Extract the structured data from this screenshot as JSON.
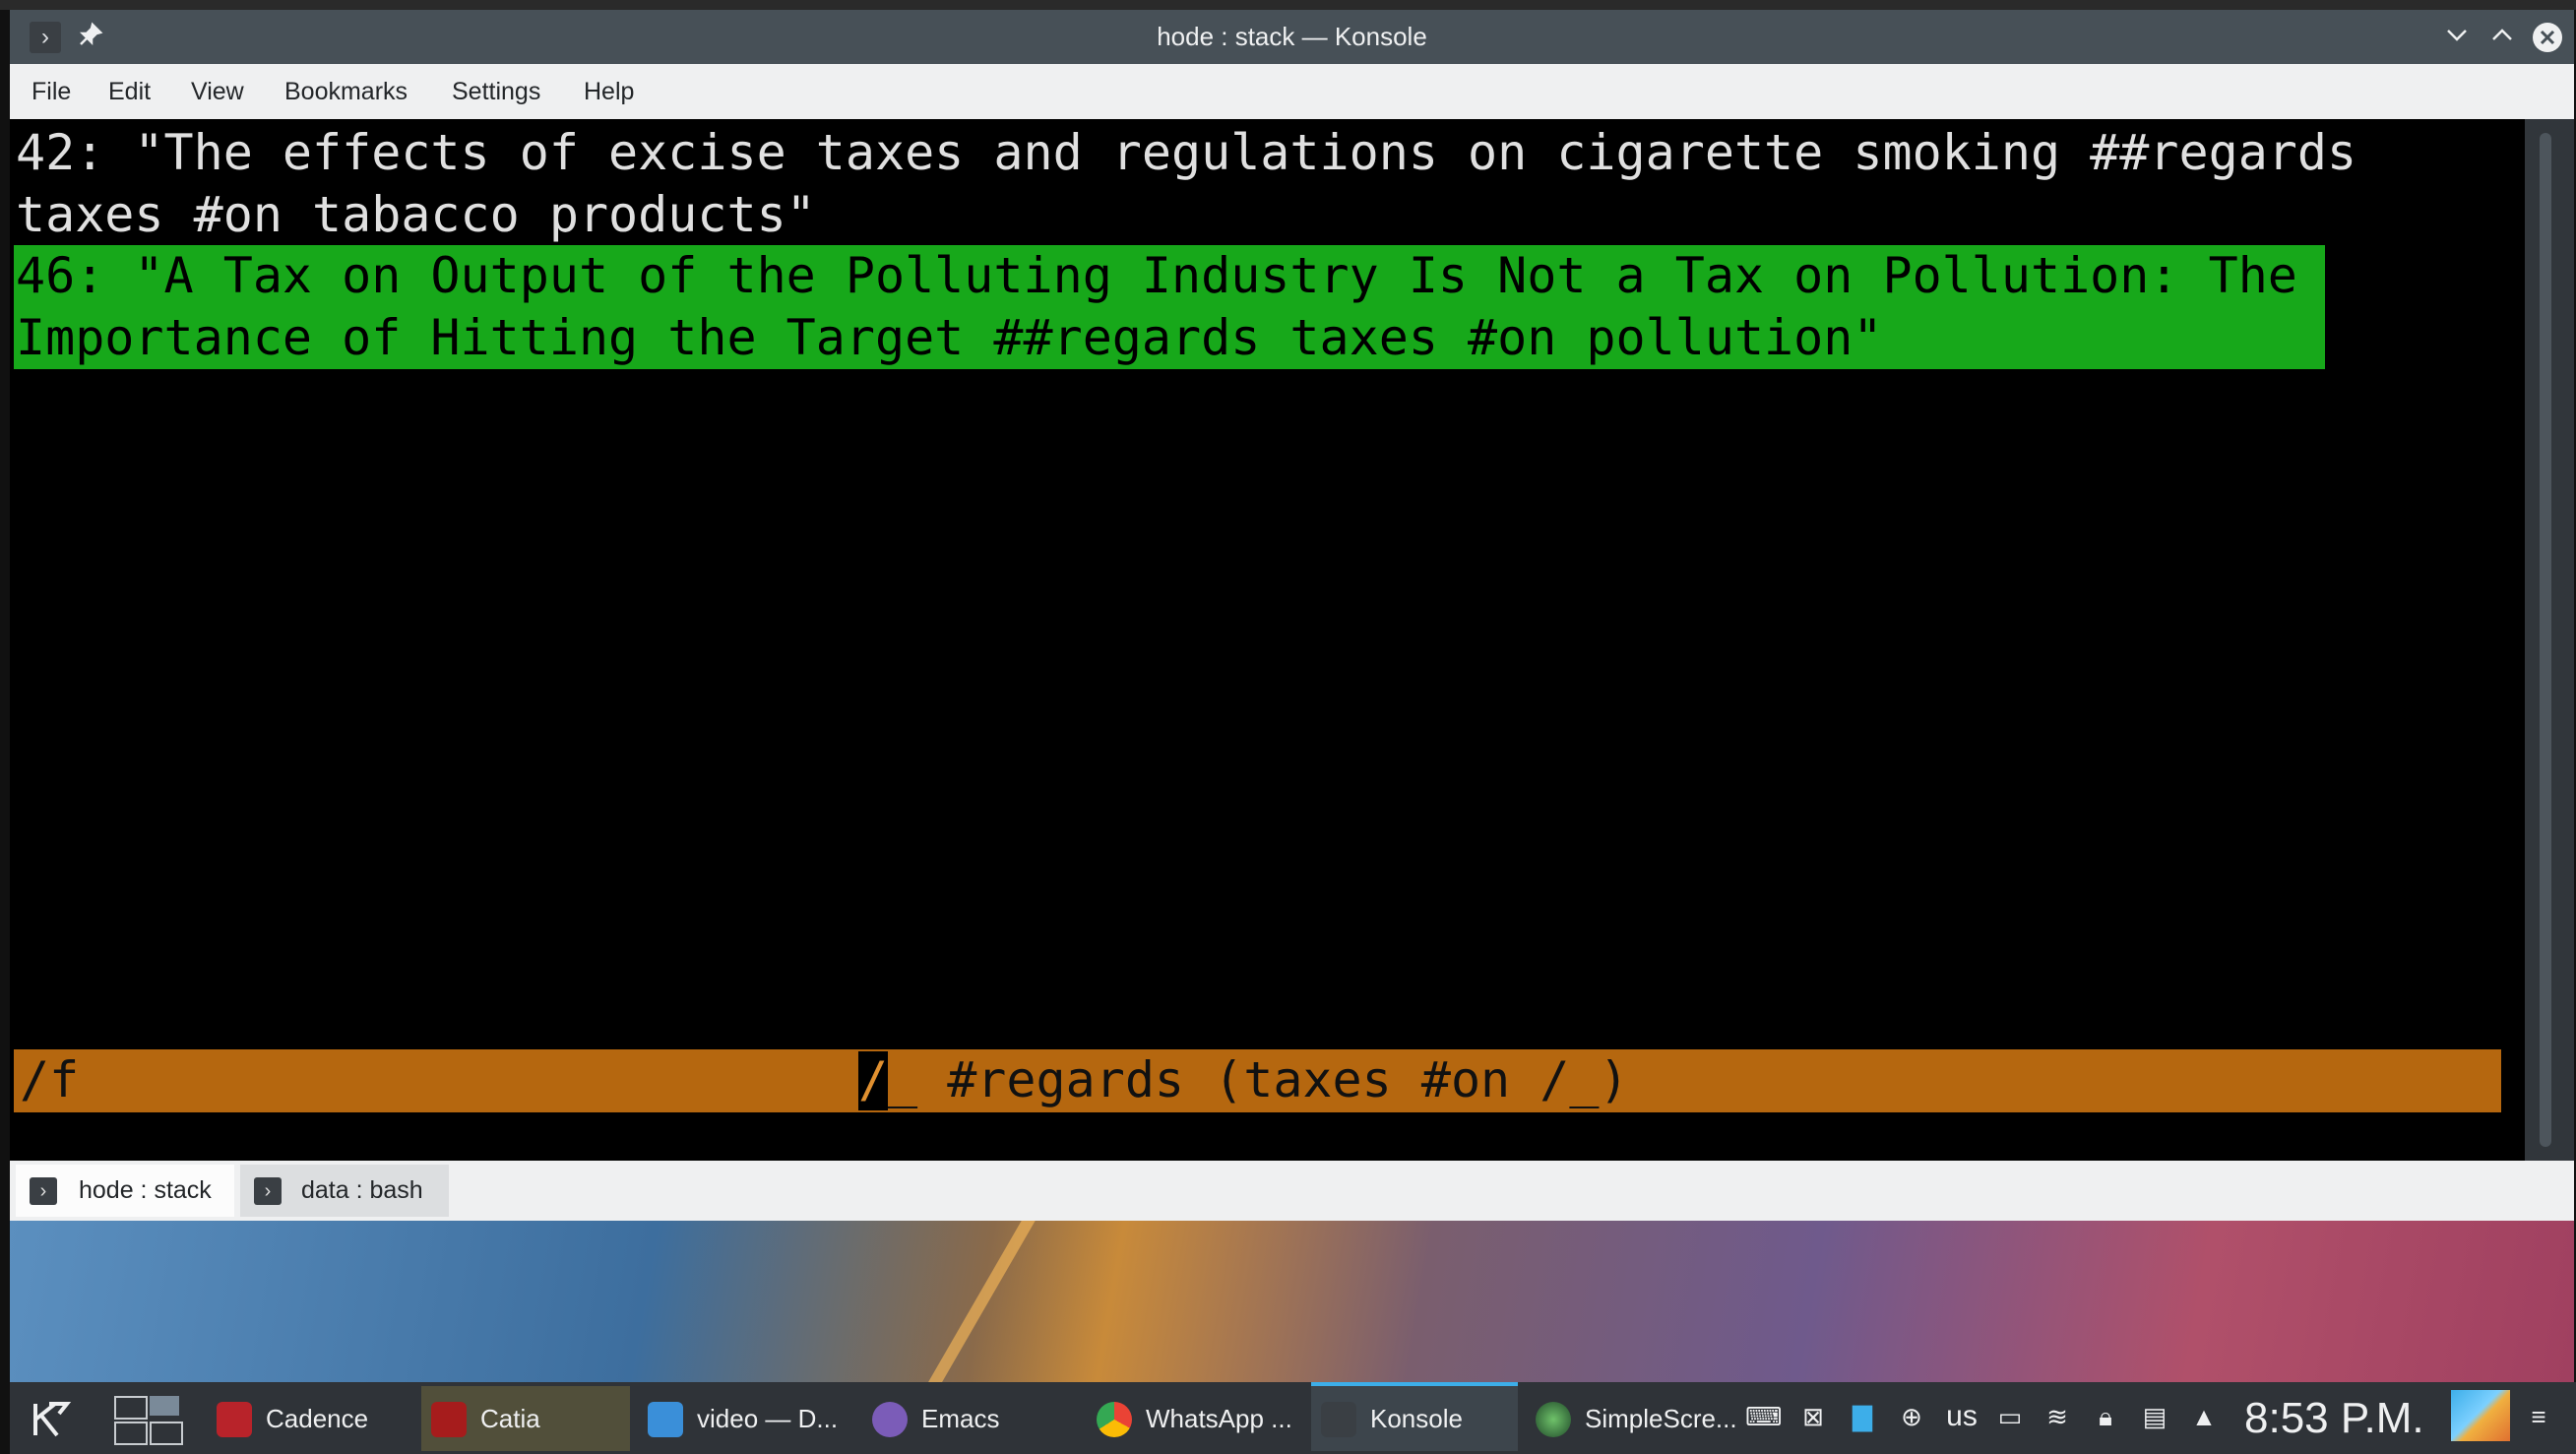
{
  "window": {
    "title": "hode : stack — Konsole",
    "icons": [
      "terminal-app-icon",
      "pin-icon",
      "minimize-chevron-icon",
      "maximize-chevron-icon",
      "close-icon"
    ]
  },
  "menu": {
    "items": [
      "File",
      "Edit",
      "View",
      "Bookmarks",
      "Settings",
      "Help"
    ]
  },
  "terminal": {
    "lines": [
      "42: \"The effects of excise taxes and regulations on cigarette smoking ##regards",
      "taxes #on tabacco products\""
    ],
    "highlighted_lines": [
      "46: \"A Tax on Output of the Polluting Industry Is Not a Tax on Pollution: The",
      "Importance of Hitting the Target ##regards taxes #on pollution\""
    ],
    "highlight_color": "#17a81a",
    "status_bar": {
      "left": "/f",
      "cursor_char": "/",
      "right": "_ #regards (taxes #on /_)",
      "color": "#b5670f"
    }
  },
  "tabs": [
    {
      "label": "hode : stack",
      "active": true
    },
    {
      "label": "data : bash",
      "active": false
    }
  ],
  "taskbar": {
    "tasks": [
      {
        "label": "Cadence"
      },
      {
        "label": "Catia"
      },
      {
        "label": "video — D..."
      },
      {
        "label": "Emacs"
      },
      {
        "label": "WhatsApp ..."
      },
      {
        "label": "Konsole"
      },
      {
        "label": "SimpleScre..."
      }
    ],
    "keyboard_layout": "us",
    "clock": "8:53 P.M.",
    "accent": "#3daee9"
  }
}
